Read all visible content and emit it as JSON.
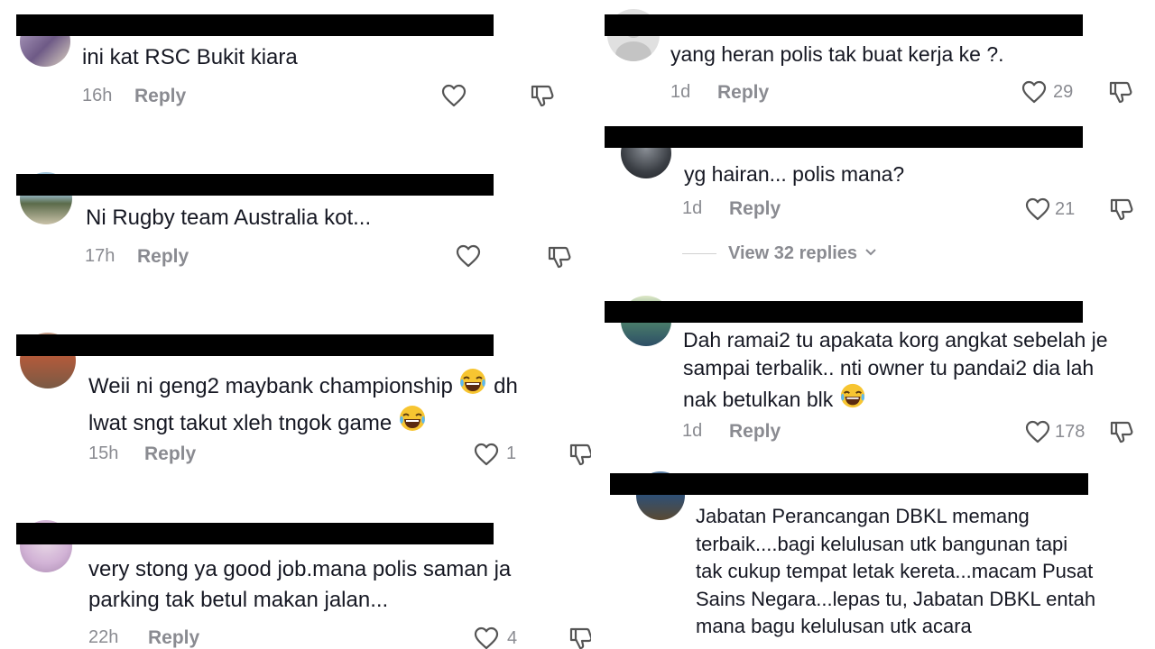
{
  "colors": {
    "text": "#161823",
    "muted": "#8a8b91",
    "redaction": "#000000"
  },
  "icons": {
    "like": "heart-icon",
    "dislike": "thumbs-down-icon",
    "expand": "chevron-down-icon"
  },
  "left_comments": [
    {
      "text": "ini kat RSC Bukit kiara",
      "time": "16h",
      "reply": "Reply",
      "likes": ""
    },
    {
      "text": "Ni Rugby team Australia kot...",
      "time": "17h",
      "reply": "Reply",
      "likes": ""
    },
    {
      "text_line1": "Weii ni geng2 maybank championship",
      "text_line1_after": "dh",
      "text_line2": "lwat sngt takut xleh tngok game",
      "time": "15h",
      "reply": "Reply",
      "likes": "1"
    },
    {
      "text": "very stong ya good job.mana polis saman ja\nparking tak betul makan jalan...",
      "time": "22h",
      "reply": "Reply",
      "likes": "4"
    }
  ],
  "right_comments": [
    {
      "text": "yang heran polis tak buat kerja ke ?.",
      "time": "1d",
      "reply": "Reply",
      "likes": "29"
    },
    {
      "text": "yg hairan... polis mana?",
      "time": "1d",
      "reply": "Reply",
      "likes": "21",
      "view_replies": "View 32 replies"
    },
    {
      "text_line1": "Dah ramai2 tu apakata korg angkat sebelah je",
      "text_line2": "sampai terbalik.. nti owner tu pandai2 dia lah",
      "text_line3": "nak betulkan blk",
      "time": "1d",
      "reply": "Reply",
      "likes": "178"
    },
    {
      "text": "Jabatan Perancangan DBKL memang\nterbaik....bagi kelulusan utk bangunan tapi\ntak cukup tempat letak kereta...macam Pusat\nSains Negara...lepas tu, Jabatan DBKL entah\nmana bagu kelulusan utk acara"
    }
  ]
}
